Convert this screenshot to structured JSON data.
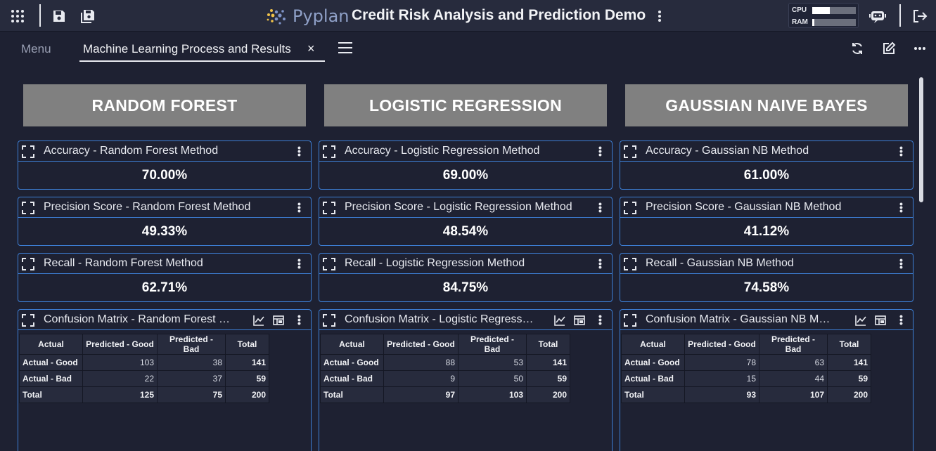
{
  "app": {
    "brand": "Pyplan",
    "title": "Credit Risk Analysis and Prediction Demo",
    "cpu_label": "CPU",
    "ram_label": "RAM",
    "cpu_usage": 0.4,
    "ram_usage": 0.05
  },
  "tabs": {
    "menu_label": "Menu",
    "active_label": "Machine Learning Process and Results",
    "close_glyph": "×"
  },
  "columns": [
    {
      "header": "RANDOM FOREST",
      "cards": [
        {
          "title": "Accuracy - Random Forest Method",
          "value": "70.00%"
        },
        {
          "title": "Precision Score - Random Forest Method",
          "value": "49.33%"
        },
        {
          "title": "Recall - Random Forest Method",
          "value": "62.71%"
        }
      ],
      "cm_title": "Confusion Matrix - Random Forest Method",
      "cm_rows": [
        [
          "Actual - Good",
          "103",
          "38",
          "141"
        ],
        [
          "Actual - Bad",
          "22",
          "37",
          "59"
        ],
        [
          "Total",
          "125",
          "75",
          "200"
        ]
      ]
    },
    {
      "header": "LOGISTIC REGRESSION",
      "cards": [
        {
          "title": "Accuracy - Logistic Regression Method",
          "value": "69.00%"
        },
        {
          "title": "Precision Score - Logistic Regression Method",
          "value": "48.54%"
        },
        {
          "title": "Recall - Logistic Regression Method",
          "value": "84.75%"
        }
      ],
      "cm_title": "Confusion Matrix - Logistic Regression Method",
      "cm_rows": [
        [
          "Actual - Good",
          "88",
          "53",
          "141"
        ],
        [
          "Actual - Bad",
          "9",
          "50",
          "59"
        ],
        [
          "Total",
          "97",
          "103",
          "200"
        ]
      ]
    },
    {
      "header": "GAUSSIAN NAIVE BAYES",
      "cards": [
        {
          "title": "Accuracy - Gaussian NB Method",
          "value": "61.00%"
        },
        {
          "title": "Precision Score - Gaussian NB Method",
          "value": "41.12%"
        },
        {
          "title": "Recall - Gaussian NB Method",
          "value": "74.58%"
        }
      ],
      "cm_title": "Confusion Matrix - Gaussian NB Method",
      "cm_rows": [
        [
          "Actual - Good",
          "78",
          "63",
          "141"
        ],
        [
          "Actual - Bad",
          "15",
          "44",
          "59"
        ],
        [
          "Total",
          "93",
          "107",
          "200"
        ]
      ]
    }
  ],
  "cm_headers": [
    "Actual",
    "Predicted - Good",
    "Predicted - Bad",
    "Total"
  ],
  "colors": {
    "accent_border": "#3d7fd6",
    "header_block": "#808080",
    "background": "#1e2132",
    "topbar": "#272b3d"
  }
}
